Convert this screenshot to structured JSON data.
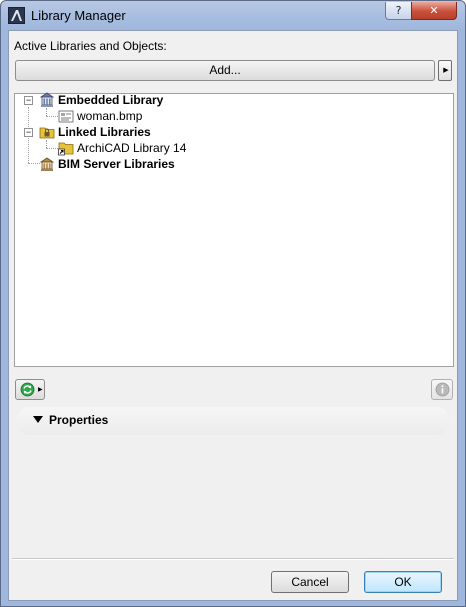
{
  "window": {
    "title": "Library Manager",
    "help_label": "?",
    "close_label": "✕"
  },
  "active_label": "Active Libraries and Objects:",
  "add_button_label": "Add...",
  "tree": {
    "embedded": {
      "label": "Embedded Library",
      "expander": "−",
      "children": [
        "woman.bmp"
      ]
    },
    "linked": {
      "label": "Linked Libraries",
      "expander": "−",
      "children": [
        "ArchiCAD Library 14"
      ]
    },
    "bim": {
      "label": "BIM Server Libraries"
    }
  },
  "properties_label": "Properties",
  "buttons": {
    "cancel": "Cancel",
    "ok": "OK"
  },
  "colors": {
    "titlebar": "#9fb7dc",
    "close_red": "#c9503a",
    "folder_yellow": "#e8c33a",
    "sync_green": "#2fa84a",
    "ok_border": "#3c7fb1"
  },
  "icons": {
    "app": "archicad-icon",
    "embedded": "library-building-icon",
    "file": "image-file-icon",
    "linked": "lock-folder-icon",
    "archicad_lib": "linked-folder-icon",
    "bim": "bim-server-library-icon",
    "sync": "sync-icon",
    "info": "info-icon"
  }
}
